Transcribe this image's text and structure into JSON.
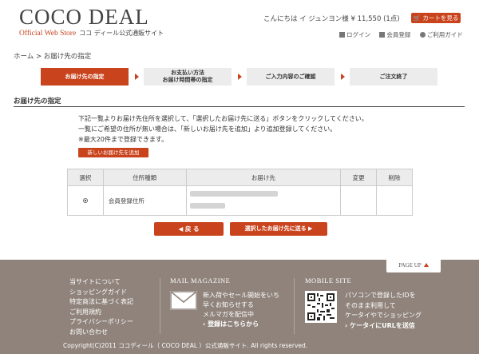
{
  "header": {
    "logo": "COCO DEAL",
    "logo_sub_en": "Official Web Store",
    "logo_sub_jp": "ココ ディール公式通販サイト",
    "greeting": "こんにちは イ ジュンヨン様 ¥ 11,550 (1点)",
    "cart_button": "カートを見る",
    "nav": {
      "login": "ログイン",
      "register": "会員登録",
      "guide": "ご利用ガイド"
    }
  },
  "breadcrumb": "ホーム > お届け先の指定",
  "steps": [
    {
      "line1": "お届け先の指定",
      "line2": ""
    },
    {
      "line1": "お支払い方法",
      "line2": "お届け時間帯の指定"
    },
    {
      "line1": "ご入力内容のご確認",
      "line2": ""
    },
    {
      "line1": "ご注文終了",
      "line2": ""
    }
  ],
  "section_title": "お届け先の指定",
  "intro": {
    "line1": "下記一覧よりお届け先住所を選択して、「選択したお届け先に送る」ボタンをクリックしてください。",
    "line2": "一覧にご希望の住所が無い場合は、「新しいお届け先を追加」より追加登録してください。",
    "line3": "※最大20件まで登録できます。"
  },
  "add_button": "新しいお届け先を追加",
  "table": {
    "headers": {
      "select": "選択",
      "type": "住所種類",
      "address": "お届け先",
      "change": "変更",
      "delete": "削除"
    },
    "rows": [
      {
        "type": "会員登録住所"
      }
    ]
  },
  "buttons": {
    "back": "◀ 戻 る",
    "send": "選択したお届け先に送る ▶"
  },
  "footer": {
    "page_top": "PAGE UP",
    "links": [
      "当サイトについて",
      "ショッピングガイド",
      "特定商法に基づく表記",
      "ご利用規約",
      "プライバシーポリシー",
      "お問い合わせ"
    ],
    "mail_heading": "MAIL MAGAZINE",
    "mail_lines": [
      "新入荷やセール開始をいち",
      "早くお知らせする",
      "メルマガを配信中",
      "› 登録はこちらから"
    ],
    "mobile_heading": "MOBILE SITE",
    "mobile_lines": [
      "パソコンで登録したIDを",
      "そのまま利用して",
      "ケータイやでショッピング",
      "› ケータイにURLを送信"
    ],
    "copyright": "Copyright(C)2011 ココディール（ COCO DEAL ）公式通販サイト. All rights reserved."
  }
}
